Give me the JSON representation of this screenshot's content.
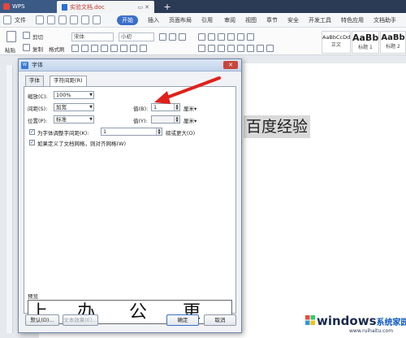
{
  "titlebar": {
    "app_tab": "WPS",
    "doc_tab": "实验文档.doc",
    "new_tab": "+"
  },
  "menu": {
    "file": "文件",
    "items": [
      "开始",
      "插入",
      "页面布局",
      "引用",
      "审阅",
      "视图",
      "章节",
      "安全",
      "开发工具",
      "特色应用",
      "文档助手"
    ],
    "active": "开始"
  },
  "ribbon": {
    "paste": "粘贴",
    "cut": "剪切",
    "copy": "复制",
    "format_painter": "格式刷",
    "font_name": "宋体",
    "font_size": "小初",
    "styles": [
      {
        "sample": "AaBbCcDd",
        "name": "正文"
      },
      {
        "sample": "AaBb",
        "name": "标题 1"
      },
      {
        "sample": "AaBb",
        "name": "标题 2"
      }
    ]
  },
  "document": {
    "visible_text": "百度经验"
  },
  "dialog": {
    "title": "字体",
    "tabs": [
      "字体",
      "字符间距(R)"
    ],
    "selected_tab": "字符间距(R)",
    "scale_label": "缩放(C):",
    "scale_value": "100%",
    "spacing_label": "间距(S):",
    "spacing_value": "加宽",
    "spacing_by_label": "值(B):",
    "spacing_by_value": "1",
    "spacing_unit": "厘米",
    "position_label": "位置(P):",
    "position_value": "标准",
    "position_by_label": "值(Y):",
    "position_by_value": "",
    "position_unit": "厘米",
    "kerning_label": "为字体调整字间距(K):",
    "kerning_value": "1",
    "kerning_suffix": "磅或更大(O)",
    "kerning_checked": true,
    "snap_grid_label": "如果定义了文档网格，则对齐网格(W)",
    "snap_grid_checked": true,
    "preview_label": "预览",
    "preview_chars": [
      "上",
      "办",
      "公",
      "更"
    ],
    "btn_default": "默认(D)...",
    "btn_text_effect": "文本效果(E)...",
    "btn_ok": "确定",
    "btn_cancel": "取消"
  },
  "watermark": {
    "brand": "windows",
    "brand_cn": "系统家园",
    "url": "www.ruihaitu.com"
  },
  "colors": {
    "accent": "#3a6fc9",
    "arrow": "#e0201b",
    "title_bar": "#2b3a55"
  }
}
